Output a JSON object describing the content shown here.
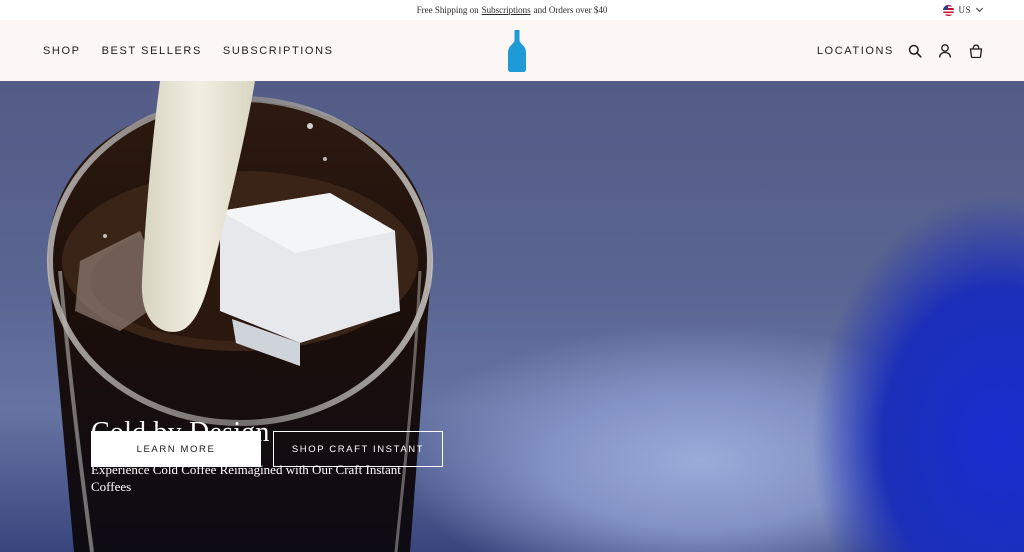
{
  "promo": {
    "text_before": "Free Shipping on",
    "link": "Subscriptions",
    "text_after": "and Orders over $40"
  },
  "locale": {
    "label": "US",
    "flag": "us-flag-icon"
  },
  "nav": {
    "left": [
      "SHOP",
      "BEST SELLERS",
      "SUBSCRIPTIONS"
    ],
    "right_label": "LOCATIONS",
    "icons": [
      "search-icon",
      "account-icon",
      "bag-icon"
    ]
  },
  "brand": {
    "logo": "blue-bottle-logo",
    "color": "#1e9ad6"
  },
  "hero": {
    "title": "Cold by Design",
    "subtitle": "Experience Cold Coffee Reimagined with Our Craft Instant Coffees",
    "primary_cta": "LEARN MORE",
    "secondary_cta": "SHOP CRAFT INSTANT"
  },
  "colors": {
    "header_bg": "#fcf7f4",
    "hero_blue": "#1b2fb8"
  }
}
